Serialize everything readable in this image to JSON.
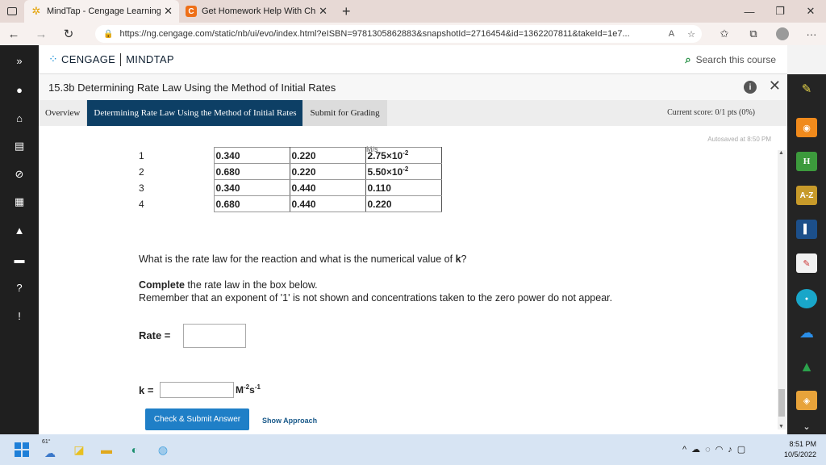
{
  "browser": {
    "tabs": [
      {
        "title": "MindTap - Cengage Learning",
        "active": true
      },
      {
        "title": "Get Homework Help With Chegg",
        "active": false
      }
    ],
    "url": "https://ng.cengage.com/static/nb/ui/evo/index.html?eISBN=9781305862883&snapshotId=2716454&id=1362207811&takeId=1e7..."
  },
  "app": {
    "brand": "CENGAGE",
    "product": "MINDTAP",
    "search_placeholder": "Search this course",
    "help_label": "?"
  },
  "activity": {
    "title": "15.3b Determining Rate Law Using the Method of Initial Rates"
  },
  "tabs": {
    "overview": "Overview",
    "current": "Determining Rate Law Using the Method of Initial Rates",
    "submit": "Submit for Grading",
    "score": "Current score: 0/1 pts (0%)"
  },
  "content": {
    "autosave": "Autosaved at 8:50 PM",
    "cutoff_header": "M/s",
    "table_rows": [
      {
        "exp": "1",
        "a": "0.340",
        "b": "0.220",
        "rate_m": "2.75×10",
        "rate_e": "-2"
      },
      {
        "exp": "2",
        "a": "0.680",
        "b": "0.220",
        "rate_m": "5.50×10",
        "rate_e": "-2"
      },
      {
        "exp": "3",
        "a": "0.340",
        "b": "0.440",
        "rate_m": "0.110",
        "rate_e": ""
      },
      {
        "exp": "4",
        "a": "0.680",
        "b": "0.440",
        "rate_m": "0.220",
        "rate_e": ""
      }
    ],
    "question_pre": "What is the rate law for the reaction and what is the numerical value of ",
    "question_k": "k",
    "question_post": "?",
    "complete_bold": "Complete",
    "complete_rest": " the rate law in the box below.",
    "remember": "Remember that an exponent of '1' is not shown and concentrations taken to the zero power do not appear.",
    "rate_label": "Rate =",
    "k_label": "k =",
    "k_unit_base1": "M",
    "k_unit_exp1": "-2",
    "k_unit_base2": "s",
    "k_unit_exp2": "-1",
    "check_button": "Check & Submit Answer",
    "show_approach": "Show Approach"
  },
  "taskbar": {
    "temperature": "61°",
    "time": "8:51 PM",
    "date": "10/5/2022"
  },
  "colors": {
    "active_tab": "#0d3f65",
    "check_button": "#1f7fc7",
    "left_rail": "#1f1f1f",
    "right_dock": "#242424"
  }
}
